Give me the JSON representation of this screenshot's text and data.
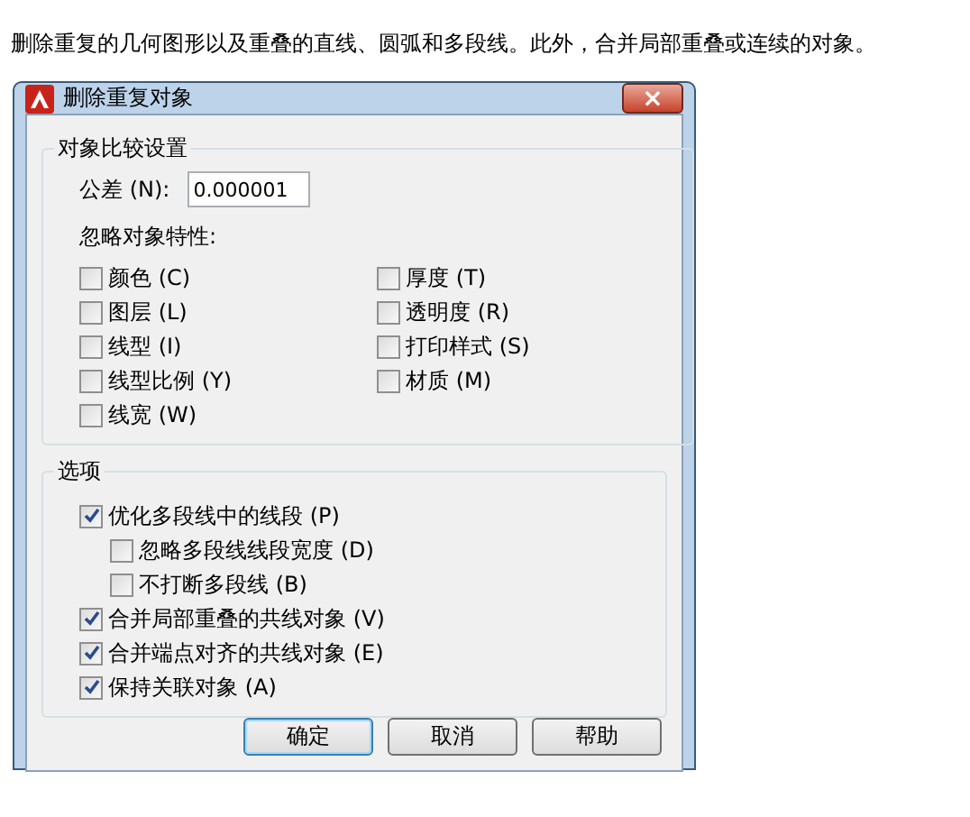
{
  "description": "删除重复的几何图形以及重叠的直线、圆弧和多段线。此外，合并局部重叠或连续的对象。",
  "window": {
    "title": "删除重复对象",
    "close": "×"
  },
  "compare_group": {
    "title": "对象比较设置",
    "tolerance": {
      "label": "公差 (N):",
      "value": "0.000001"
    },
    "ignore_label": "忽略对象特性:",
    "properties": [
      {
        "label": "颜色 (C)",
        "checked": false
      },
      {
        "label": "图层 (L)",
        "checked": false
      },
      {
        "label": "线型 (I)",
        "checked": false
      },
      {
        "label": "线型比例 (Y)",
        "checked": false
      },
      {
        "label": "线宽 (W)",
        "checked": false
      },
      {
        "label": "厚度 (T)",
        "checked": false
      },
      {
        "label": "透明度 (R)",
        "checked": false
      },
      {
        "label": "打印样式 (S)",
        "checked": false
      },
      {
        "label": "材质 (M)",
        "checked": false
      }
    ]
  },
  "options_group": {
    "title": "选项",
    "options": [
      {
        "label": "优化多段线中的线段 (P)",
        "checked": true,
        "children": [
          {
            "label": "忽略多段线线段宽度 (D)",
            "checked": false
          },
          {
            "label": "不打断多段线 (B)",
            "checked": false
          }
        ]
      },
      {
        "label": "合并局部重叠的共线对象 (V)",
        "checked": true
      },
      {
        "label": "合并端点对齐的共线对象 (E)",
        "checked": true
      },
      {
        "label": "保持关联对象 (A)",
        "checked": true
      }
    ]
  },
  "buttons": [
    {
      "label": "确定",
      "selected": true
    },
    {
      "label": "取消",
      "selected": false
    },
    {
      "label": "帮助",
      "selected": false
    }
  ]
}
